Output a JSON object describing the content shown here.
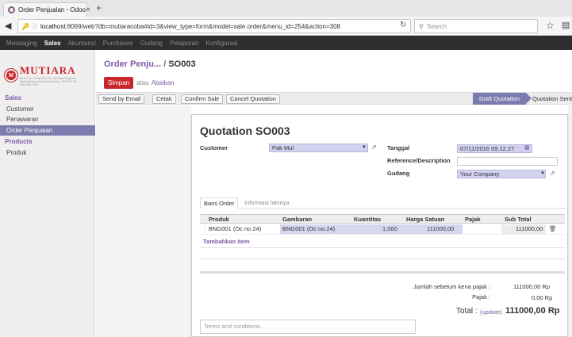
{
  "browser": {
    "tab_title": "Order Penjualan - Odoo",
    "tab_close": "×",
    "new_tab": "+",
    "url_host": "localhost",
    "url_rest": ":8069/web?db=mutiaracoba#id=3&view_type=form&model=sale.order&menu_id=254&action=308",
    "search_placeholder": "Search"
  },
  "topnav": {
    "items": [
      "Messaging",
      "Sales",
      "Akuntansi",
      "Purchases",
      "Gudang",
      "Pelaporan",
      "Konfigurasi"
    ],
    "active": "Sales"
  },
  "logo": {
    "brand": "MUTIARA",
    "address": "Blok F Lt.1 D.uly NNO No. 28 Pasar Regional Tanah Abang Jakarta Pusat Telp. 7500943 HP. 0813 981 6751"
  },
  "sidebar": {
    "sections": [
      {
        "title": "Sales",
        "items": [
          "Customer",
          "Penawaran",
          "Order Penjualan"
        ]
      },
      {
        "title": "Products",
        "items": [
          "Produk"
        ]
      }
    ],
    "active_item": "Order Penjualan"
  },
  "breadcrumb": {
    "parent": "Order Penju...",
    "separator": " / ",
    "current": "SO003"
  },
  "actions": {
    "save": "Simpan",
    "or": "atau",
    "discard": "Abaikan"
  },
  "statusbar": {
    "buttons": [
      "Send by Email",
      "Cetak",
      "Confirm Sale",
      "Cancel Quotation"
    ],
    "stages": [
      "Draft Quotation",
      "Quotation Sent"
    ],
    "active_stage": "Draft Quotation"
  },
  "form": {
    "title": "Quotation SO003",
    "customer_label": "Customer",
    "customer_value": "Pak Mul",
    "date_label": "Tanggal",
    "date_value": "07/11/2016 09.12.27",
    "ref_label": "Reference/Description",
    "ref_value": "",
    "warehouse_label": "Gudang",
    "warehouse_value": "Your Company"
  },
  "tabs": [
    "Baris Order",
    "Informasi lainnya"
  ],
  "order_lines": {
    "headers": [
      "Produk",
      "Gambaran",
      "Kuantitas",
      "Harga Satuan",
      "Pajak",
      "Sub Total"
    ],
    "rows": [
      {
        "product": "BNG001 (Oc no.24)",
        "description": "BNG001 (Oc no.24)",
        "qty": "1,000",
        "price": "111000,00",
        "tax": "",
        "subtotal": "111000,00"
      }
    ],
    "add_item": "Tambahkan item"
  },
  "totals": {
    "untaxed_label": "Jumlah sebelum kena pajak :",
    "untaxed_value": "111000,00 Rp",
    "tax_label": "Pajak :",
    "tax_value": "0,00 Rp",
    "total_label": "Total :",
    "update_label": "(update)",
    "total_value": "111000,00 Rp"
  },
  "terms_placeholder": "Terms and conditions..."
}
